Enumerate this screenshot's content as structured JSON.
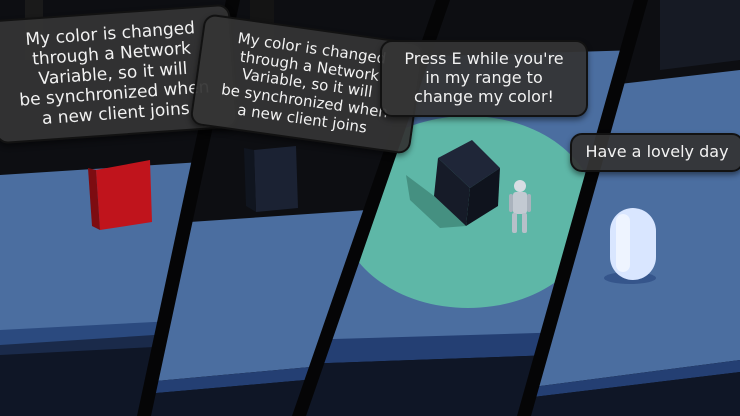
{
  "panels": [
    {
      "id": "red-cube-panel",
      "speech": [
        "My color is changed",
        "through a Network",
        "Variable, so it will",
        "be synchronized when",
        "a new client joins"
      ]
    },
    {
      "id": "dark-cube-panel",
      "speech": [
        "My color is changed",
        "through a Network",
        "Variable, so it will",
        "be synchronized when",
        "a new client joins"
      ]
    },
    {
      "id": "range-panel",
      "speech": [
        "Press E while you're",
        "in my range to",
        "change my color!"
      ]
    },
    {
      "id": "capsule-panel",
      "speech": [
        "Have a lovely day"
      ]
    }
  ],
  "colors": {
    "floor_blue": "#4b6ea0",
    "floor_edge": "#243f73",
    "wall_dark": "#0e0f14",
    "cube_red": "#c0141c",
    "cube_dark": "#1b2233",
    "range_area": "#5eb7a7",
    "capsule": "#d9e6ff",
    "bubble_bg": "#343434",
    "bubble_text": "#f2f2f2"
  },
  "icons": [
    "player-robot-icon"
  ]
}
